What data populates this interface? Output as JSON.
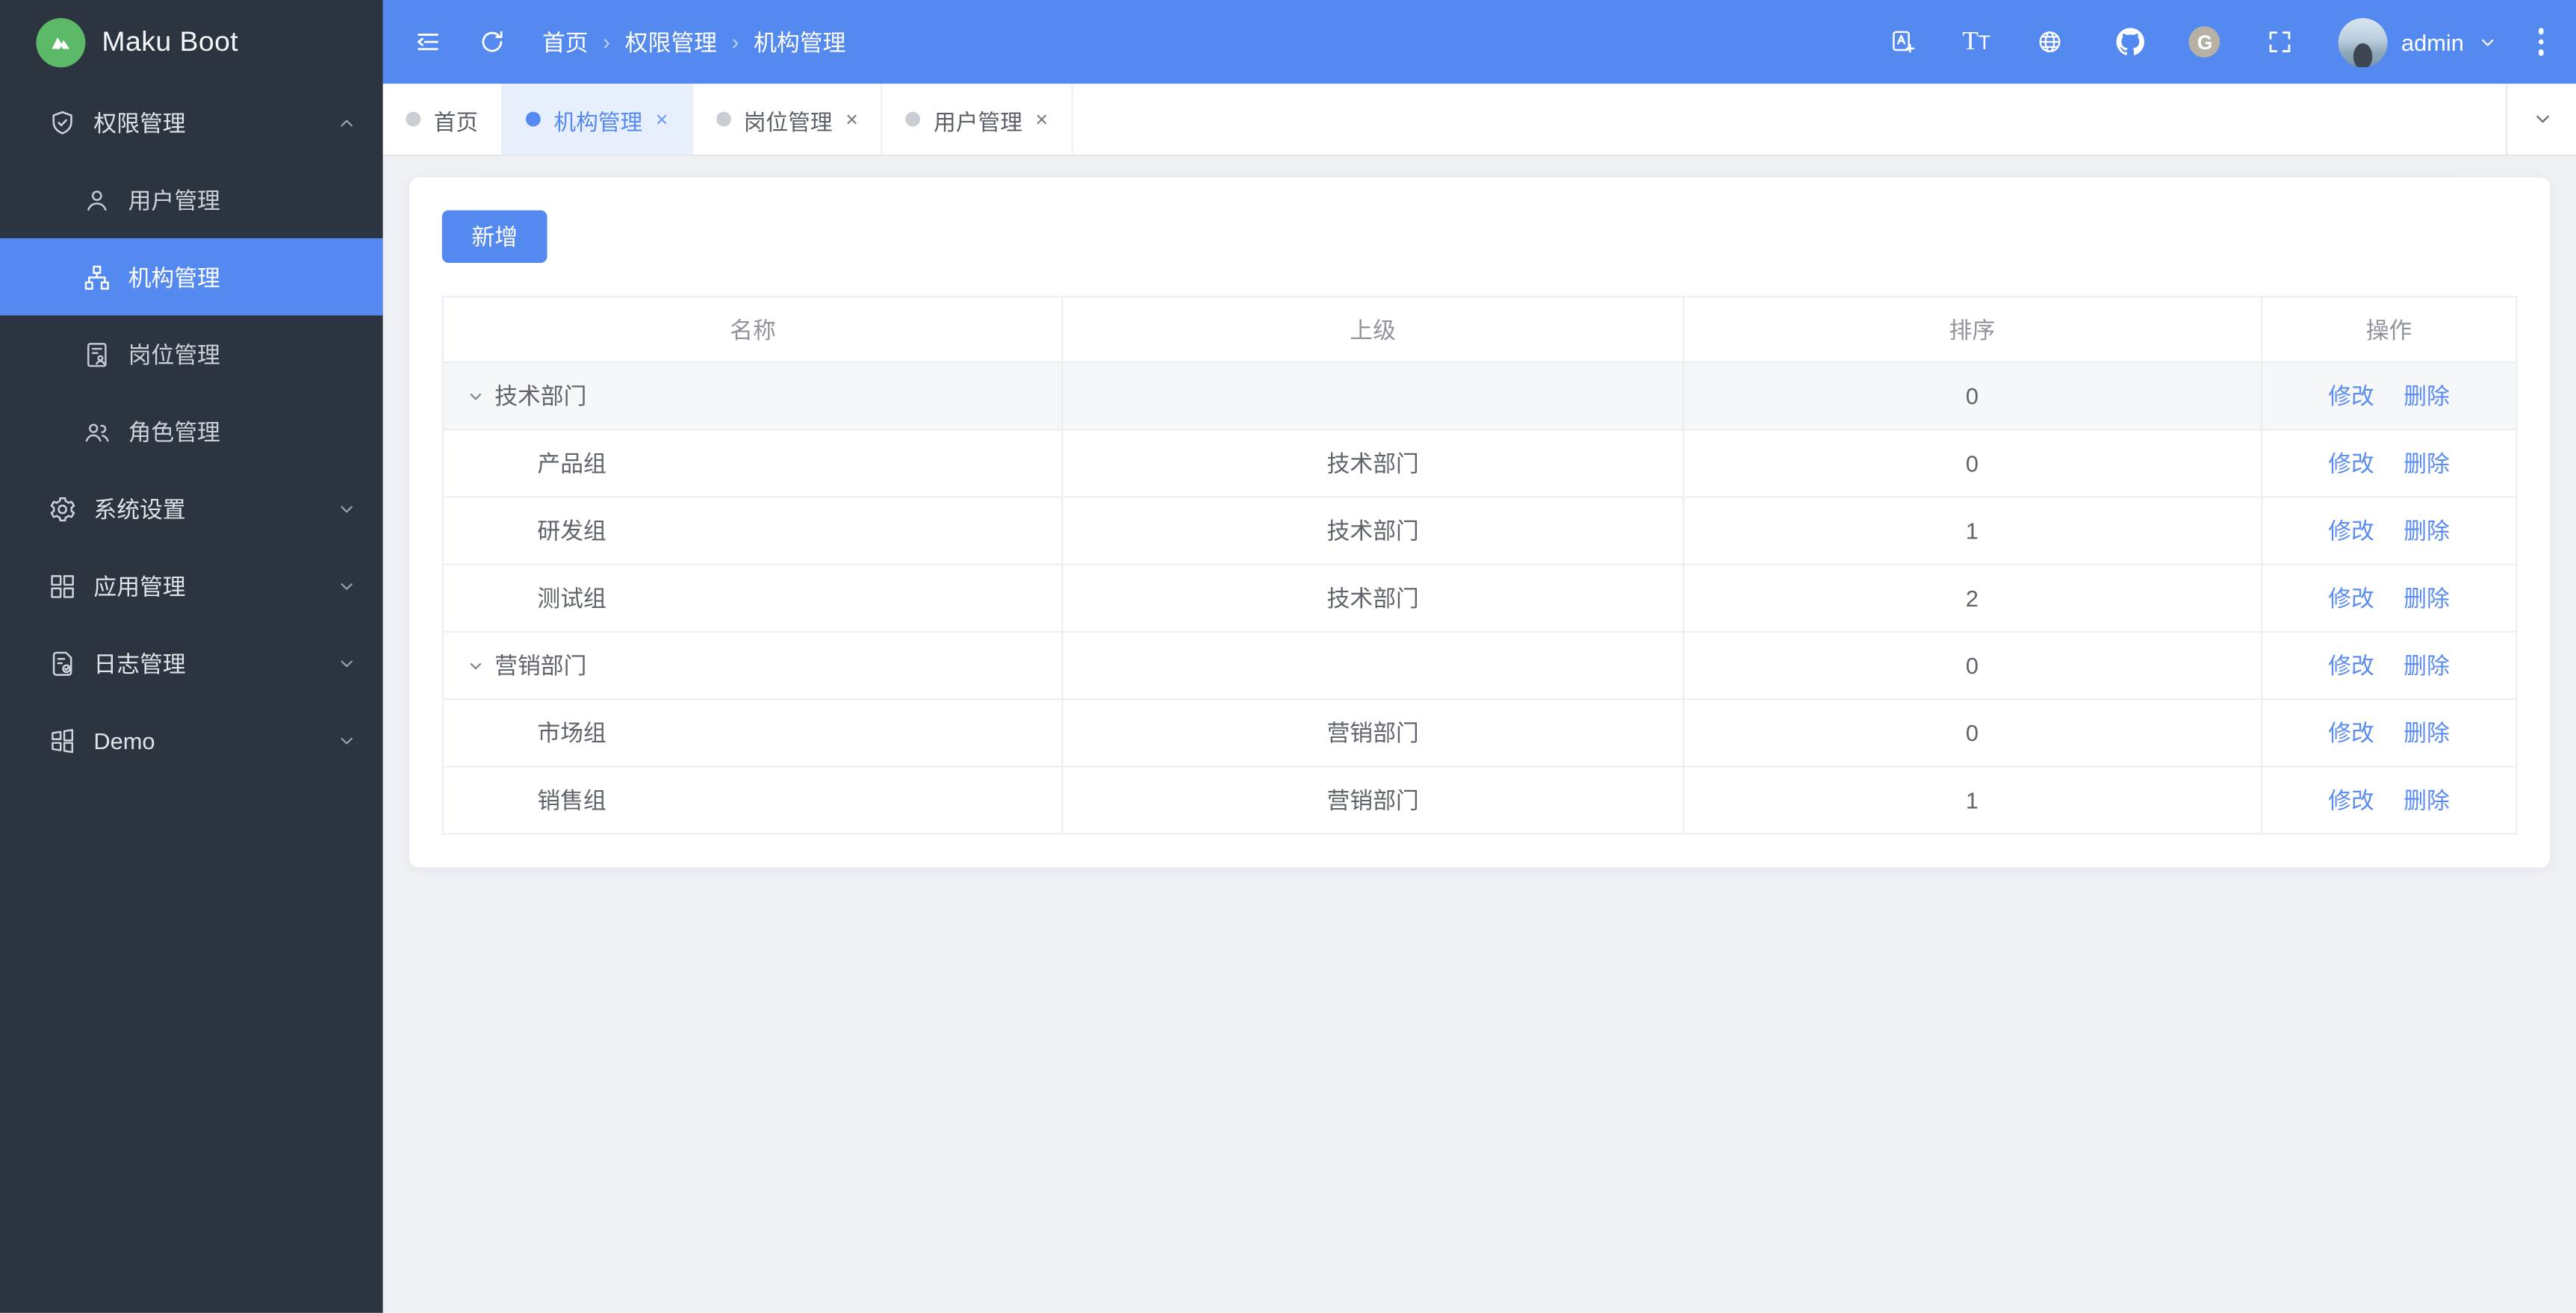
{
  "app": {
    "name": "Maku Boot",
    "logo_icon": "mountain-logo-icon"
  },
  "header": {
    "breadcrumb": {
      "items": [
        "首页",
        "权限管理",
        "机构管理"
      ],
      "separator": "›"
    },
    "tool_icons": [
      {
        "icon": "menu-fold-icon"
      },
      {
        "icon": "refresh-icon"
      }
    ],
    "right_icons": [
      {
        "icon": "translate-icon"
      },
      {
        "icon": "font-size-icon",
        "glyph": "Tt"
      },
      {
        "icon": "globe-icon"
      },
      {
        "icon": "github-icon"
      },
      {
        "icon": "gitee-icon",
        "glyph": "G"
      },
      {
        "icon": "fullscreen-icon"
      }
    ],
    "user": {
      "name": "admin"
    }
  },
  "sidebar": {
    "items": [
      {
        "label": "权限管理",
        "icon": "shield-check-icon",
        "type": "group",
        "expanded": true
      },
      {
        "label": "用户管理",
        "icon": "user-icon",
        "type": "child",
        "active": false
      },
      {
        "label": "机构管理",
        "icon": "org-chart-icon",
        "type": "child",
        "active": true
      },
      {
        "label": "岗位管理",
        "icon": "post-doc-icon",
        "type": "child",
        "active": false
      },
      {
        "label": "角色管理",
        "icon": "roles-icon",
        "type": "child",
        "active": false
      },
      {
        "label": "系统设置",
        "icon": "gear-icon",
        "type": "group",
        "expanded": false
      },
      {
        "label": "应用管理",
        "icon": "apps-grid-icon",
        "type": "group",
        "expanded": false
      },
      {
        "label": "日志管理",
        "icon": "log-doc-icon",
        "type": "group",
        "expanded": false
      },
      {
        "label": "Demo",
        "icon": "demo-grid-icon",
        "type": "group",
        "expanded": false
      }
    ]
  },
  "tabs": {
    "items": [
      {
        "label": "首页",
        "active": false,
        "closable": false
      },
      {
        "label": "机构管理",
        "active": true,
        "closable": true
      },
      {
        "label": "岗位管理",
        "active": false,
        "closable": true
      },
      {
        "label": "用户管理",
        "active": false,
        "closable": true
      }
    ],
    "close_glyph": "×"
  },
  "main": {
    "add_button": "新增",
    "table": {
      "headers": [
        "名称",
        "上级",
        "排序",
        "操作"
      ],
      "actions": {
        "edit": "修改",
        "delete": "删除"
      },
      "rows": [
        {
          "name": "技术部门",
          "parent": "",
          "sort": "0",
          "level": 0,
          "expanded": true
        },
        {
          "name": "产品组",
          "parent": "技术部门",
          "sort": "0",
          "level": 1,
          "expanded": false
        },
        {
          "name": "研发组",
          "parent": "技术部门",
          "sort": "1",
          "level": 1,
          "expanded": false
        },
        {
          "name": "测试组",
          "parent": "技术部门",
          "sort": "2",
          "level": 1,
          "expanded": false
        },
        {
          "name": "营销部门",
          "parent": "",
          "sort": "0",
          "level": 0,
          "expanded": true
        },
        {
          "name": "市场组",
          "parent": "营销部门",
          "sort": "0",
          "level": 1,
          "expanded": false
        },
        {
          "name": "销售组",
          "parent": "营销部门",
          "sort": "1",
          "level": 1,
          "expanded": false
        }
      ]
    }
  },
  "colors": {
    "primary": "#5489f0",
    "header_bg": "#5489f0",
    "sidebar_bg": "#2b343f",
    "active_tab_bg": "#e7eefc",
    "content_bg": "#eef0f4",
    "link": "#5a8cf2",
    "logo_green": "#5cb968",
    "table_border": "#ebeef5"
  }
}
